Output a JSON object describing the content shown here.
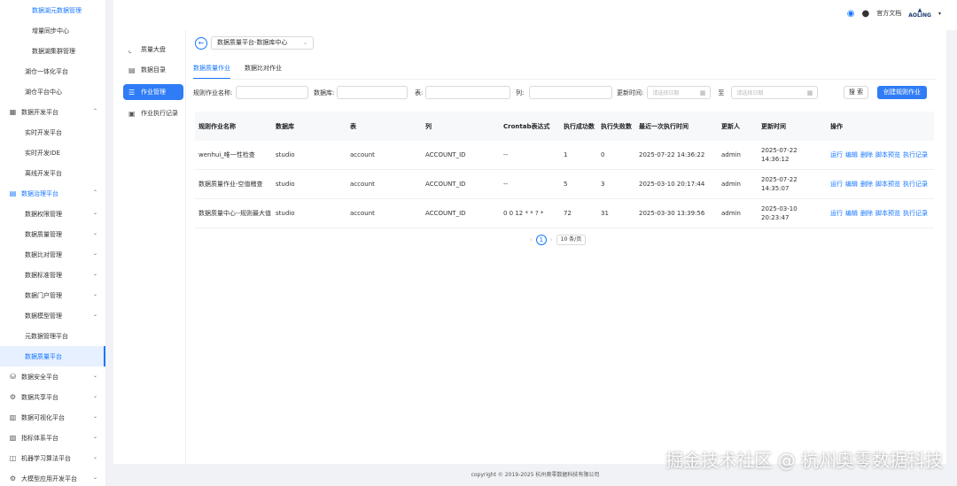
{
  "sidebar": {
    "items": [
      {
        "label": "数据湖元数据管理",
        "level": 3
      },
      {
        "label": "增量同步中心",
        "level": 3
      },
      {
        "label": "数据湖集群管理",
        "level": 3
      },
      {
        "label": "湖仓一体化平台",
        "level": 2
      },
      {
        "label": "湖仓平台中心",
        "level": 2
      },
      {
        "label": "数据开发平台",
        "level": 1,
        "icon": "▦",
        "chevron": "⌃"
      },
      {
        "label": "实时开发平台",
        "level": 2
      },
      {
        "label": "实时开发IDE",
        "level": 2
      },
      {
        "label": "离线开发平台",
        "level": 2
      },
      {
        "label": "数据治理平台",
        "level": 1,
        "icon": "▤",
        "chevron": "⌃"
      },
      {
        "label": "数据权限管理",
        "level": 2,
        "chevron": "⌄"
      },
      {
        "label": "数据质量管理",
        "level": 2,
        "chevron": "⌄"
      },
      {
        "label": "数据比对管理",
        "level": 2,
        "chevron": "⌄"
      },
      {
        "label": "数据标准管理",
        "level": 2,
        "chevron": "⌄"
      },
      {
        "label": "数据门户管理",
        "level": 2,
        "chevron": "⌄"
      },
      {
        "label": "数据模型管理",
        "level": 2,
        "chevron": "⌄"
      },
      {
        "label": "元数据管理平台",
        "level": 2
      },
      {
        "label": "数据质量平台",
        "level": 2
      },
      {
        "label": "数据安全平台",
        "level": 1,
        "icon": "⛁",
        "chevron": "⌄"
      },
      {
        "label": "数据共享平台",
        "level": 1,
        "icon": "⚙",
        "chevron": "⌄"
      },
      {
        "label": "数据可视化平台",
        "level": 1,
        "icon": "▥",
        "chevron": "⌄"
      },
      {
        "label": "指标体系平台",
        "level": 1,
        "icon": "▧",
        "chevron": "⌄"
      },
      {
        "label": "机器学习算法平台",
        "level": 1,
        "icon": "◫",
        "chevron": "⌄"
      },
      {
        "label": "大模型应用开发平台",
        "level": 1,
        "icon": "⚙",
        "chevron": "⌄"
      }
    ]
  },
  "header": {
    "doc_label": "官方文档",
    "logo_text": "AOLING",
    "caret": "▾"
  },
  "inner_nav": {
    "items": [
      {
        "label": "质量大盘",
        "icon": "📈"
      },
      {
        "label": "数据目录",
        "icon": "▤"
      },
      {
        "label": "作业管理",
        "icon": "☰"
      },
      {
        "label": "作业执行记录",
        "icon": "▣"
      }
    ]
  },
  "main": {
    "back_icon": "←",
    "datasource": "数据质量平台-数据库中心",
    "tabs": [
      "数据质量作业",
      "数据比对作业"
    ],
    "filters": {
      "rule_name_label": "规则作业名称:",
      "db_label": "数据库:",
      "table_label": "表:",
      "column_label": "列:",
      "update_time_label": "更新时间:",
      "date_placeholder": "请选择日期",
      "to_label": "至"
    },
    "search_btn": "搜 索",
    "create_btn": "创建规则作业",
    "table": {
      "headers": [
        "规则作业名称",
        "数据库",
        "表",
        "列",
        "Crontab表达式",
        "执行成功数",
        "执行失败数",
        "最近一次执行时间",
        "更新人",
        "更新时间",
        "操作"
      ],
      "rows": [
        [
          "wenhui_唯一性检查",
          "studio",
          "account",
          "ACCOUNT_ID",
          "--",
          "1",
          "0",
          "2025-07-22 14:36:22",
          "admin",
          "2025-07-22 14:36:12"
        ],
        [
          "数据质量作业-空值稽查",
          "studio",
          "account",
          "ACCOUNT_ID",
          "--",
          "5",
          "3",
          "2025-03-10 20:17:44",
          "admin",
          "2025-07-22 14:35:07"
        ],
        [
          "数据质量中心--规则最大值",
          "studio",
          "account",
          "ACCOUNT_ID",
          "0 0 12 * * ? *",
          "72",
          "31",
          "2025-03-30 13:39:56",
          "admin",
          "2025-03-10 20:23:47"
        ]
      ],
      "ops": [
        "运行",
        "编辑",
        "删除",
        "脚本预览",
        "执行记录"
      ]
    },
    "pagination": {
      "prev": "‹",
      "page": "1",
      "next": "›",
      "page_size": "10 条/页"
    }
  },
  "footer": "copyright © 2019-2025 杭州奥零数据科技有限公司",
  "watermark": "掘金技术社区 @ 杭州奥零数据科技"
}
